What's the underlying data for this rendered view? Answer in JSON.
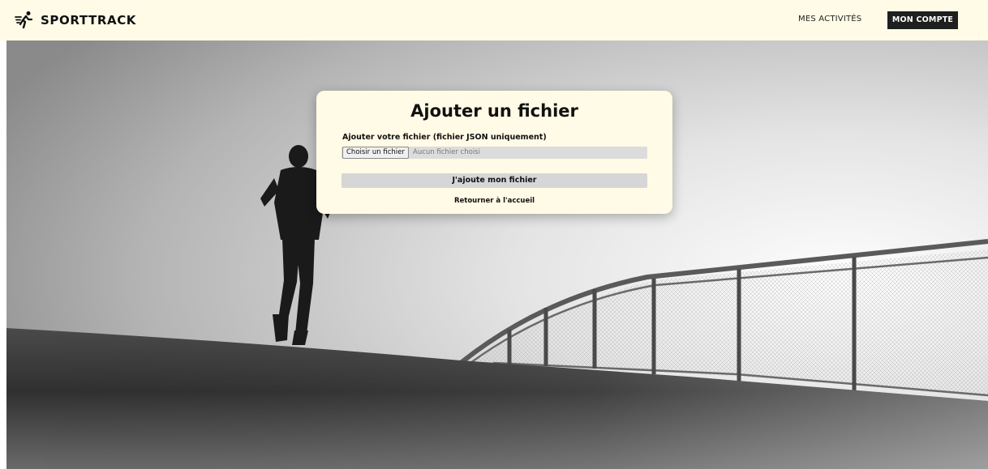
{
  "header": {
    "brand": "SPORTTRACK",
    "logo_icon": "runner-icon",
    "nav": {
      "activities_label": "MES ACTIVITÉS",
      "account_label": "MON COMPTE"
    }
  },
  "form": {
    "title": "Ajouter un fichier",
    "field_label": "Ajouter votre fichier (fichier JSON uniquement)",
    "file_button_label": "Choisir un fichier",
    "file_status": "Aucun fichier choisi",
    "submit_label": "J'ajoute mon fichier",
    "back_link_label": "Retourner à l'accueil"
  },
  "colors": {
    "header_bg": "#fffbe6",
    "card_bg": "#fffbe6",
    "account_button_bg": "#1f1f1f",
    "submit_button_bg": "#d6d6d6"
  }
}
